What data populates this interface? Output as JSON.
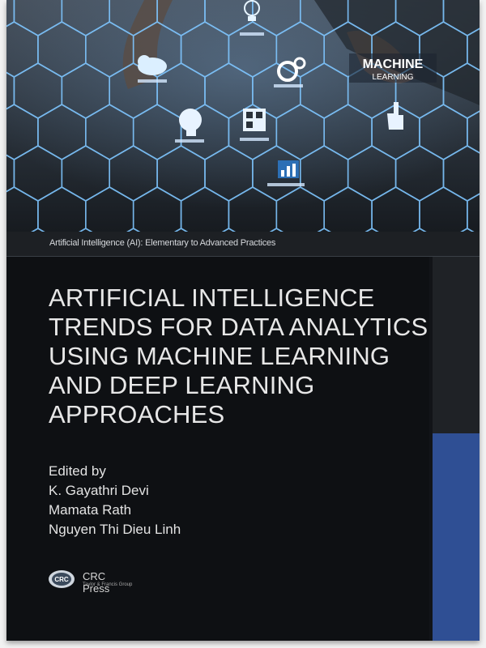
{
  "cover": {
    "series": "Artificial Intelligence (AI): Elementary to Advanced Practices",
    "title_lines": [
      "ARTIFICIAL INTELLIGENCE",
      "TRENDS FOR DATA ANALYTICS",
      "USING MACHINE LEARNING",
      "AND DEEP LEARNING",
      "APPROACHES"
    ],
    "edited_by_label": "Edited by",
    "editors": [
      "K. Gayathri Devi",
      "Mamata Rath",
      "Nguyen Thi Dieu Linh"
    ],
    "publisher": {
      "name": "CRC Press",
      "tagline": "Taylor & Francis Group",
      "logo_text": "CRC"
    },
    "hero_labels": {
      "machine_line1": "MACHINE",
      "machine_line2": "LEARNING"
    },
    "colors": {
      "background": "#121418",
      "accent_blue": "#2f4f94",
      "hex_outline": "#7fc6ff"
    },
    "icons": [
      "lightbulb-icon",
      "cloud-icon",
      "gears-icon",
      "head-icon",
      "qr-icon",
      "chart-icon",
      "hand-icon"
    ]
  }
}
